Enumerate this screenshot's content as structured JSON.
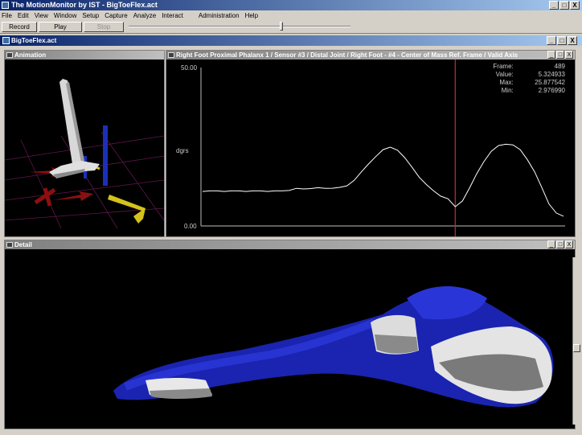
{
  "app": {
    "title": "The MotionMonitor by IST - BigToeFlex.act",
    "window_controls": [
      "_",
      "□",
      "X"
    ]
  },
  "menu": [
    "File",
    "Edit",
    "View",
    "Window",
    "Setup",
    "Capture",
    "Analyze",
    "Interact",
    "Administration",
    "Help"
  ],
  "toolbar": {
    "record_label": "Record",
    "play_label": "Play",
    "stop_label": "Stop"
  },
  "document": {
    "title": "BigToeFlex.act"
  },
  "panes": {
    "animation": {
      "title": "Animation"
    },
    "graph": {
      "title": "Right Foot Proximal Phalanx 1 / Sensor #3 / Distal Joint / Right Foot - #4 - Center of Mass Ref. Frame / Valid Axis",
      "y_max_label": "50.00",
      "y_min_label": "0.00",
      "unit_label": "dgrs",
      "readout": {
        "frame_label": "Frame:",
        "frame_value": "489",
        "value_label": "Value:",
        "value_value": "5.324933",
        "max_label": "Max:",
        "max_value": "25.877542",
        "min_label": "Min:",
        "min_value": "2.976990"
      }
    },
    "detail": {
      "title": "Detail"
    }
  },
  "chart_data": {
    "type": "line",
    "ylim": [
      0,
      50
    ],
    "cursor_frame": 489,
    "series": [
      {
        "color": "#ffffff",
        "values": [
          11,
          11,
          11,
          11,
          11,
          11,
          11,
          11,
          11,
          11,
          11,
          11,
          11.3,
          11.8,
          11.6,
          11.9,
          12,
          11.8,
          12,
          12.1,
          12.6,
          14.5,
          17,
          19.5,
          22,
          24,
          24.8,
          24,
          21.5,
          18.5,
          15.5,
          13,
          11,
          9.5,
          8.5,
          6,
          8,
          12,
          16.5,
          20.5,
          23.5,
          25.3,
          25.9,
          25.5,
          24,
          21,
          17,
          12,
          7,
          4,
          3
        ]
      }
    ],
    "colors": {
      "cursor": "#c0302c",
      "axis": "#bbbbbb"
    }
  }
}
